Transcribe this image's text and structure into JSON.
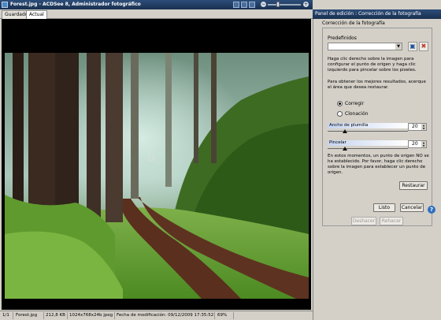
{
  "window": {
    "title": "Forest.jpg - ACDSee 8, Administrador fotográfico"
  },
  "tabs": [
    {
      "label": "Guardado"
    },
    {
      "label": "Actual"
    }
  ],
  "status": {
    "page": "1/1",
    "filename": "Forest.jpg",
    "size": "212,8 KB",
    "dimensions": "1024x768x24b jpeg",
    "modified": "Fecha de modificación: 09/12/2009 17:35:52",
    "zoom": "69%"
  },
  "panel": {
    "header": "Panel de edición : Corrección de la fotografía",
    "section_title": "Corrección de la fotografía",
    "presets_label": "Predefinidos",
    "instructions1": "Haga clic derecho sobre la imagen para configurar el punto de origen y haga clic izquierdo para pincelar sobre los pixeles.",
    "instructions2": "Para obtener los mejores resultados, acerque el área que desea restaurar.",
    "radio_correct": "Corregir",
    "radio_clone": "Clonación",
    "feather_label": "Ancho de plumilla",
    "feather_value": "20",
    "feather_level": 0.2,
    "brush_label": "Pincelar",
    "brush_value": "20",
    "brush_level": 0.2,
    "origin_note": "En estos momentos, un punto de origen NO se ha establecido. Por favor, haga clic derecho sobre la imagen para establecer un punto de origen.",
    "restore_label": "Restaurar",
    "done_label": "Listo",
    "cancel_label": "Cancelar",
    "undo_label": "Deshacer",
    "redo_label": "Rehacer"
  }
}
